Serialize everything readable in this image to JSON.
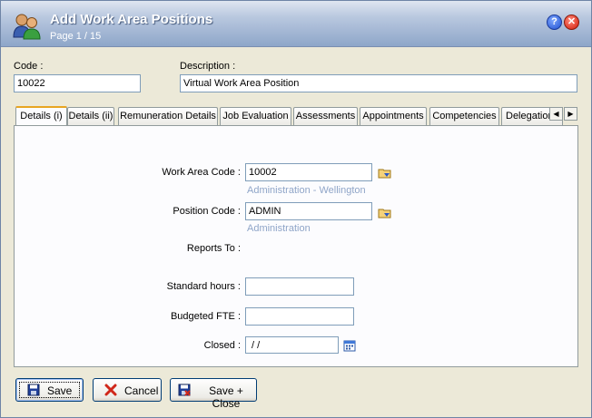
{
  "window": {
    "title": "Add Work Area Positions",
    "subtitle": "Page 1 / 15"
  },
  "header": {
    "code_label": "Code :",
    "code_value": "10022",
    "description_label": "Description :",
    "description_value": "Virtual Work Area Position"
  },
  "tabs": [
    {
      "label": "Details (i)",
      "active": true
    },
    {
      "label": "Details (ii)"
    },
    {
      "label": "Remuneration Details"
    },
    {
      "label": "Job Evaluation"
    },
    {
      "label": "Assessments"
    },
    {
      "label": "Appointments"
    },
    {
      "label": "Competencies"
    },
    {
      "label": "Delegations"
    }
  ],
  "details": {
    "work_area_code_label": "Work Area Code :",
    "work_area_code_value": "10002",
    "work_area_name": "Administration - Wellington",
    "position_code_label": "Position Code :",
    "position_code_value": "ADMIN",
    "position_name": "Administration",
    "reports_to_label": "Reports To :",
    "standard_hours_label": "Standard hours :",
    "standard_hours_value": "",
    "budgeted_fte_label": "Budgeted FTE :",
    "budgeted_fte_value": "",
    "closed_label": "Closed :",
    "closed_value": " / /"
  },
  "buttons": {
    "save": "Save",
    "cancel": "Cancel",
    "save_close": "Save + Close"
  },
  "icons": {
    "app": "users-icon",
    "help": "help-icon",
    "close": "close-icon",
    "lookup": "folder-lookup-icon",
    "calendar": "calendar-icon",
    "save": "floppy-disk-icon",
    "cancel": "red-x-icon"
  }
}
